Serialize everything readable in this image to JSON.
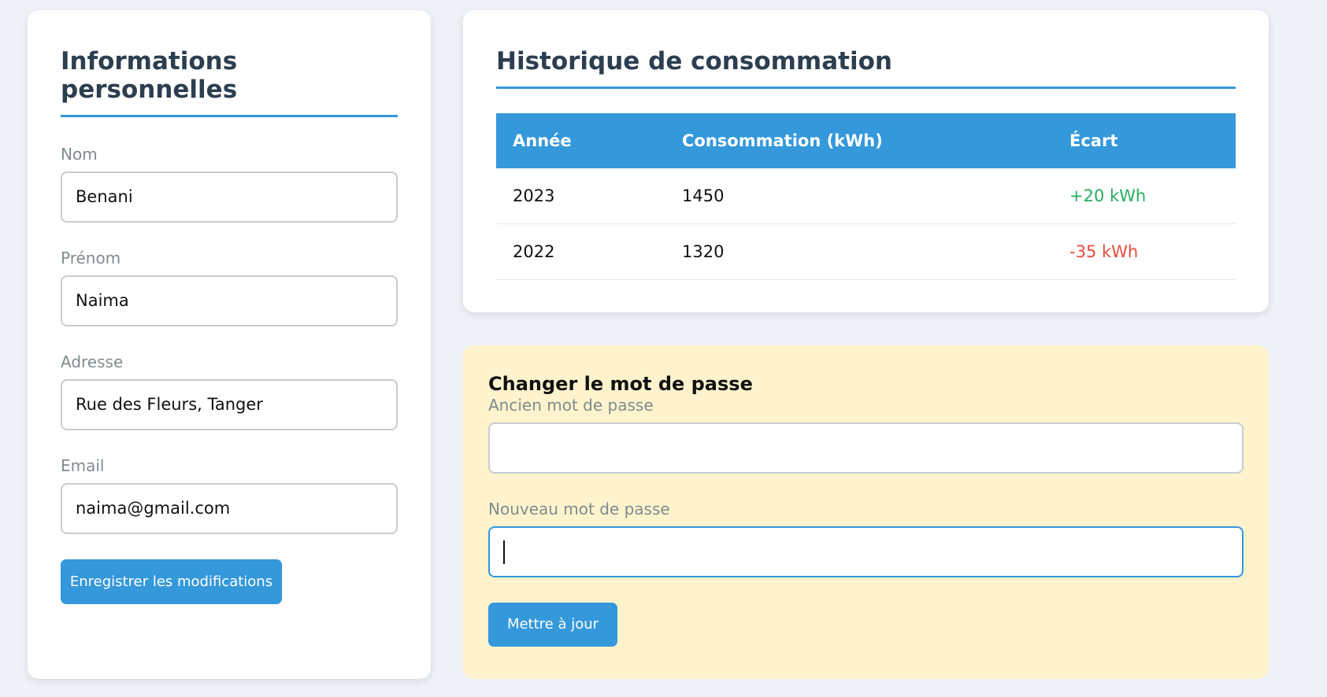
{
  "personal": {
    "title": "Informations personnelles",
    "fields": [
      {
        "label": "Nom",
        "value": "Benani"
      },
      {
        "label": "Prénom",
        "value": "Naima"
      },
      {
        "label": "Adresse",
        "value": "Rue des Fleurs, Tanger"
      },
      {
        "label": "Email",
        "value": "naima@gmail.com"
      }
    ],
    "save_label": "Enregistrer les modifications"
  },
  "history": {
    "title": "Historique de consommation",
    "headers": [
      "Année",
      "Consommation (kWh)",
      "Écart"
    ],
    "rows": [
      {
        "year": "2023",
        "consumption": "1450",
        "diff": "+20 kWh",
        "trend": "up"
      },
      {
        "year": "2022",
        "consumption": "1320",
        "diff": "-35 kWh",
        "trend": "down"
      }
    ]
  },
  "password": {
    "title": "Changer le mot de passe",
    "old_label": "Ancien mot de passe",
    "old_value": "",
    "new_label": "Nouveau mot de passe",
    "new_value": "",
    "update_label": "Mettre à jour"
  },
  "colors": {
    "accent": "#3498db",
    "positive": "#27ae60",
    "negative": "#e74c3c",
    "warning_bg": "#fff3cd",
    "page_bg": "#eef2f7"
  }
}
